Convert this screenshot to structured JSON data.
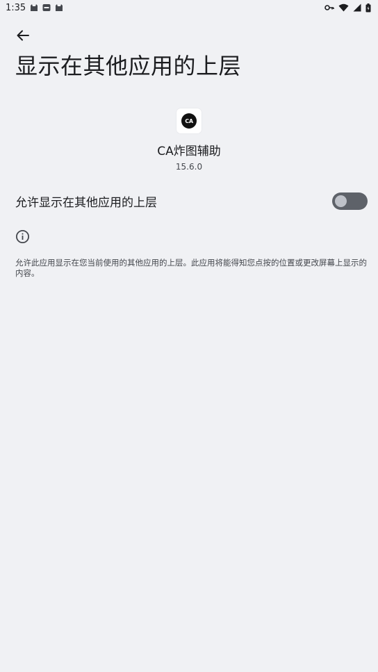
{
  "status_bar": {
    "time": "1:35",
    "notification_icons": [
      "cat-icon",
      "app-badge-icon",
      "cat-icon"
    ],
    "system_icons": [
      "key-icon",
      "wifi-icon",
      "signal-icon",
      "battery-icon"
    ]
  },
  "header": {
    "back_icon": "arrow-back-icon",
    "title": "显示在其他应用的上层"
  },
  "app": {
    "icon_text": "CA",
    "name": "CA炸图辅助",
    "version": "15.6.0"
  },
  "permission": {
    "label": "允许显示在其他应用的上层",
    "enabled": false
  },
  "info": {
    "icon": "info-icon",
    "description": "允许此应用显示在您当前使用的其他应用的上层。此应用将能得知您点按的位置或更改屏幕上显示的内容。"
  },
  "colors": {
    "background": "#f0f1f4",
    "switch_track_off": "#5e6269",
    "switch_thumb_off": "#bfc2c9"
  }
}
